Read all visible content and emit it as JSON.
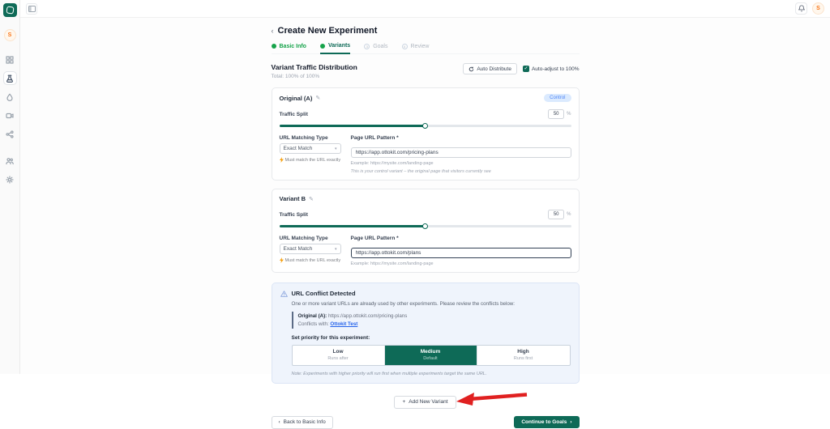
{
  "topbar": {
    "avatar_initial": "S"
  },
  "sidebar": {
    "avatar_initial": "S",
    "active_item": "experiments",
    "items": [
      "dashboard",
      "experiments",
      "engagement",
      "recordings",
      "integrations",
      "team",
      "settings"
    ]
  },
  "page": {
    "back_chevron": "‹",
    "title": "Create New Experiment"
  },
  "steps": [
    {
      "label": "Basic Info",
      "state": "complete"
    },
    {
      "label": "Variants",
      "state": "active"
    },
    {
      "label": "Goals",
      "state": "upcoming",
      "number": "3"
    },
    {
      "label": "Review",
      "state": "upcoming",
      "number": "4"
    }
  ],
  "distribution": {
    "heading": "Variant Traffic Distribution",
    "total": "Total: 100% of 100%",
    "auto_distribute_label": "Auto Distribute",
    "auto_adjust_label": "Auto-adjust to 100%",
    "check_glyph": "✓"
  },
  "variants": [
    {
      "name": "Original (A)",
      "edit_glyph": "✎",
      "badge": "Control",
      "traffic_label": "Traffic Split",
      "split_value": "50",
      "percent_sign": "%",
      "matching_label": "URL Matching Type",
      "matching_value": "Exact Match",
      "dropdown_glyph": "▾",
      "matching_warning": "Must match the URL exactly",
      "url_label": "Page URL Pattern *",
      "url_value": "https://app.ottokit.com/pricing-plans",
      "url_example": "Example: https://mysite.com/landing-page",
      "control_note": "This is your control variant – the original page that visitors currently see"
    },
    {
      "name": "Variant B",
      "edit_glyph": "✎",
      "traffic_label": "Traffic Split",
      "split_value": "50",
      "percent_sign": "%",
      "matching_label": "URL Matching Type",
      "matching_value": "Exact Match",
      "dropdown_glyph": "▾",
      "matching_warning": "Must match the URL exactly",
      "url_label": "Page URL Pattern *",
      "url_value": "https://app.ottokit.com/plans",
      "url_example": "Example: https://mysite.com/landing-page"
    }
  ],
  "conflict": {
    "title": "URL Conflict Detected",
    "description": "One or more variant URLs are already used by other experiments. Please review the conflicts below:",
    "item": {
      "variant_label": "Original (A):",
      "url": "https://app.ottokit.com/pricing-plans",
      "conflicts_label": "Conflicts with:",
      "conflicts_link": "Ottokit Test"
    },
    "priority_heading": "Set priority for this experiment:",
    "priorities": [
      {
        "label": "Low",
        "sub": "Runs after"
      },
      {
        "label": "Medium",
        "sub": "Default",
        "selected": true
      },
      {
        "label": "High",
        "sub": "Runs first"
      }
    ],
    "note": "Note: Experiments with higher priority will run first when multiple experiments target the same URL."
  },
  "actions": {
    "plus_glyph": "+",
    "add_variant": "Add New Variant",
    "back_chevron": "‹",
    "back": "Back to Basic Info",
    "continue": "Continue to Goals",
    "forward_chevron": "›"
  },
  "colors": {
    "primary": "#0E6A57",
    "step_green": "#16A34A",
    "control_badge_bg": "#DBEAFE",
    "control_badge_text": "#4F86F7",
    "conflict_bg": "#EFF4FC",
    "link": "#2563EB",
    "warning_orange": "#F59E0B",
    "arrow_red": "#E02020"
  }
}
